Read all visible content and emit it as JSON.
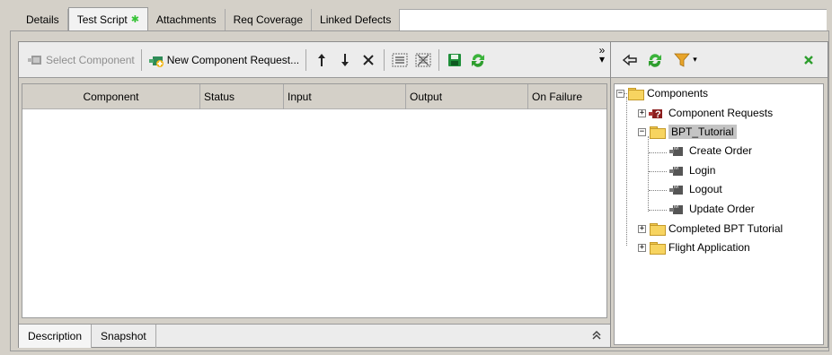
{
  "tabs": [
    {
      "label": "Details"
    },
    {
      "label": "Test Script",
      "active": true,
      "modified_mark": "✱"
    },
    {
      "label": "Attachments"
    },
    {
      "label": "Req Coverage"
    },
    {
      "label": "Linked Defects"
    }
  ],
  "toolbar": {
    "select_component": "Select Component",
    "new_component_request": "New Component Request...",
    "overflow": "»"
  },
  "grid": {
    "columns": [
      "Component",
      "Status",
      "Input",
      "Output",
      "On Failure"
    ],
    "rows": []
  },
  "bottom_tabs": {
    "description": "Description",
    "snapshot": "Snapshot"
  },
  "tree": {
    "root": "Components",
    "items": {
      "component_requests": "Component Requests",
      "bpt_tutorial": "BPT_Tutorial",
      "create_order": "Create Order",
      "login": "Login",
      "logout": "Logout",
      "update_order": "Update Order",
      "completed_bpt_tutorial": "Completed BPT Tutorial",
      "flight_application": "Flight Application"
    },
    "selected": "BPT_Tutorial"
  },
  "colors": {
    "accent_green": "#2e9e2e",
    "refresh_green": "#3bb33b",
    "filter_orange": "#e8a52a",
    "folder_yellow": "#f7d460",
    "selection_gray": "#c4c4c4"
  }
}
